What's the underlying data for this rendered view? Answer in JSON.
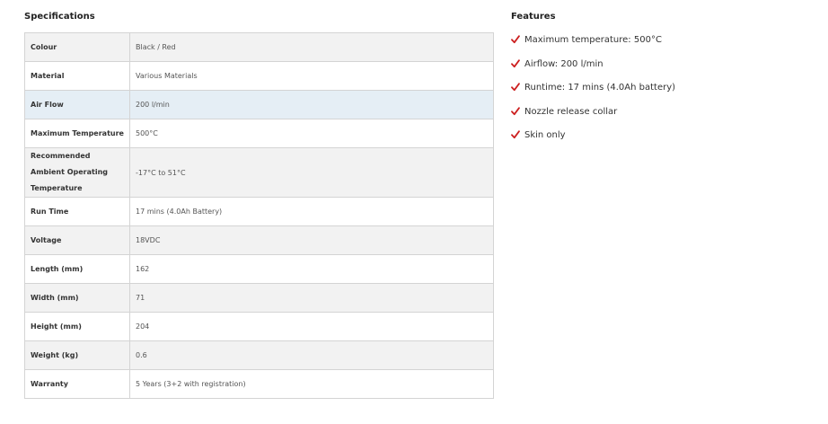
{
  "specifications": {
    "title": "Specifications",
    "rows": [
      {
        "label": "Colour",
        "value": "Black / Red"
      },
      {
        "label": "Material",
        "value": "Various Materials"
      },
      {
        "label": "Air Flow",
        "value": "200 l/min"
      },
      {
        "label": "Maximum Temperature",
        "value": "500°C"
      },
      {
        "label": "Recommended Ambient Operating Temperature",
        "value": "-17°C to 51°C"
      },
      {
        "label": "Run Time",
        "value": "17 mins (4.0Ah Battery)"
      },
      {
        "label": "Voltage",
        "value": "18VDC"
      },
      {
        "label": "Length (mm)",
        "value": "162"
      },
      {
        "label": "Width (mm)",
        "value": "71"
      },
      {
        "label": "Height (mm)",
        "value": "204"
      },
      {
        "label": "Weight (kg)",
        "value": "0.6"
      },
      {
        "label": "Warranty",
        "value": "5 Years (3+2 with registration)"
      }
    ]
  },
  "features": {
    "title": "Features",
    "items": [
      {
        "icon": "checkmark-icon",
        "text": "Maximum temperature: 500°C"
      },
      {
        "icon": "checkmark-icon",
        "text": "Airflow: 200 l/min"
      },
      {
        "icon": "checkmark-icon",
        "text": "Runtime: 17 mins (4.0Ah battery)"
      },
      {
        "icon": "checkmark-icon",
        "text": "Nozzle release collar"
      },
      {
        "icon": "checkmark-icon",
        "text": "Skin only"
      }
    ]
  },
  "colors": {
    "check": "#cc1f1f",
    "row_alt": "#f2f2f2",
    "row_highlight": "#e5eef5",
    "border": "#d4d4d4"
  }
}
